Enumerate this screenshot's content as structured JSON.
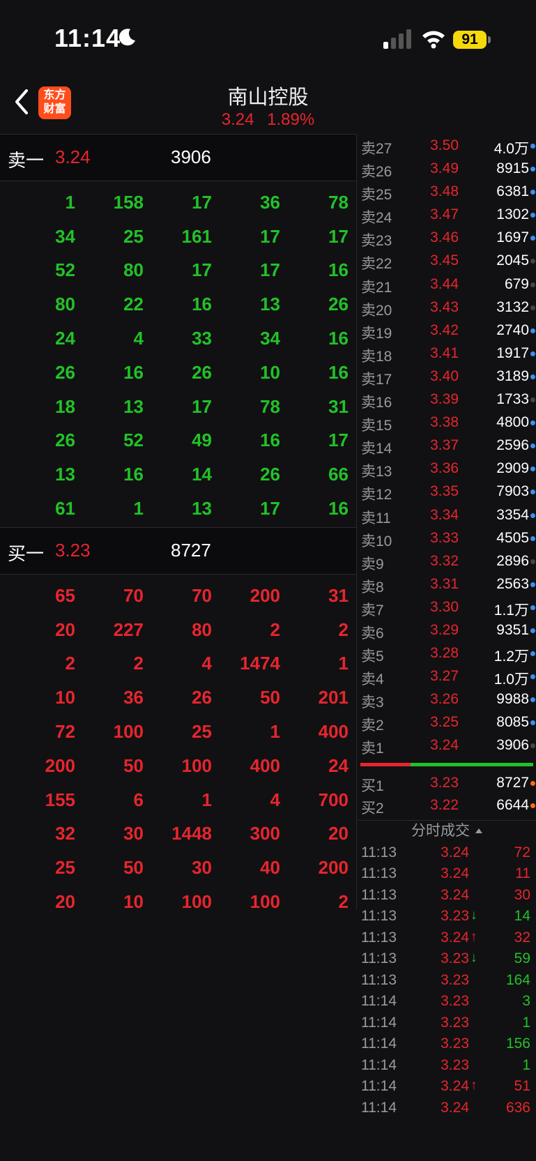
{
  "status": {
    "time": "11:14",
    "battery": "91"
  },
  "header": {
    "logo_line1": "东方",
    "logo_line2": "财富",
    "stock_name": "南山控股",
    "price": "3.24",
    "change_pct": "1.89%"
  },
  "colors": {
    "red": "#e8252d",
    "green": "#22c227",
    "blue_dot": "#3e8ef0",
    "gray_dot": "#444448",
    "orange_dot": "#ff6a1a"
  },
  "sell_block": {
    "label": "卖一",
    "price": "3.24",
    "volume": "3906",
    "rows": [
      [
        "1",
        "158",
        "17",
        "36",
        "78"
      ],
      [
        "34",
        "25",
        "161",
        "17",
        "17"
      ],
      [
        "52",
        "80",
        "17",
        "17",
        "16"
      ],
      [
        "80",
        "22",
        "16",
        "13",
        "26"
      ],
      [
        "24",
        "4",
        "33",
        "34",
        "16"
      ],
      [
        "26",
        "16",
        "26",
        "10",
        "16"
      ],
      [
        "18",
        "13",
        "17",
        "78",
        "31"
      ],
      [
        "26",
        "52",
        "49",
        "16",
        "17"
      ],
      [
        "13",
        "16",
        "14",
        "26",
        "66"
      ],
      [
        "61",
        "1",
        "13",
        "17",
        "16"
      ]
    ]
  },
  "buy_block": {
    "label": "买一",
    "price": "3.23",
    "volume": "8727",
    "rows": [
      [
        "65",
        "70",
        "70",
        "200",
        "31"
      ],
      [
        "20",
        "227",
        "80",
        "2",
        "2"
      ],
      [
        "2",
        "2",
        "4",
        "1474",
        "1"
      ],
      [
        "10",
        "36",
        "26",
        "50",
        "201"
      ],
      [
        "72",
        "100",
        "25",
        "1",
        "400"
      ],
      [
        "200",
        "50",
        "100",
        "400",
        "24"
      ],
      [
        "155",
        "6",
        "1",
        "4",
        "700"
      ],
      [
        "32",
        "30",
        "1448",
        "300",
        "20"
      ],
      [
        "25",
        "50",
        "30",
        "40",
        "200"
      ],
      [
        "20",
        "10",
        "100",
        "100",
        "2"
      ]
    ]
  },
  "asks": [
    {
      "label": "卖27",
      "price": "3.50",
      "vol": "4.0万",
      "dot": "blue"
    },
    {
      "label": "卖26",
      "price": "3.49",
      "vol": "8915",
      "dot": "blue"
    },
    {
      "label": "卖25",
      "price": "3.48",
      "vol": "6381",
      "dot": "blue"
    },
    {
      "label": "卖24",
      "price": "3.47",
      "vol": "1302",
      "dot": "blue"
    },
    {
      "label": "卖23",
      "price": "3.46",
      "vol": "1697",
      "dot": "blue"
    },
    {
      "label": "卖22",
      "price": "3.45",
      "vol": "2045",
      "dot": "gray"
    },
    {
      "label": "卖21",
      "price": "3.44",
      "vol": "679",
      "dot": "gray"
    },
    {
      "label": "卖20",
      "price": "3.43",
      "vol": "3132",
      "dot": "gray"
    },
    {
      "label": "卖19",
      "price": "3.42",
      "vol": "2740",
      "dot": "blue"
    },
    {
      "label": "卖18",
      "price": "3.41",
      "vol": "1917",
      "dot": "blue"
    },
    {
      "label": "卖17",
      "price": "3.40",
      "vol": "3189",
      "dot": "blue"
    },
    {
      "label": "卖16",
      "price": "3.39",
      "vol": "1733",
      "dot": "gray"
    },
    {
      "label": "卖15",
      "price": "3.38",
      "vol": "4800",
      "dot": "blue"
    },
    {
      "label": "卖14",
      "price": "3.37",
      "vol": "2596",
      "dot": "blue"
    },
    {
      "label": "卖13",
      "price": "3.36",
      "vol": "2909",
      "dot": "blue"
    },
    {
      "label": "卖12",
      "price": "3.35",
      "vol": "7903",
      "dot": "blue"
    },
    {
      "label": "卖11",
      "price": "3.34",
      "vol": "3354",
      "dot": "blue"
    },
    {
      "label": "卖10",
      "price": "3.33",
      "vol": "4505",
      "dot": "blue"
    },
    {
      "label": "卖9",
      "price": "3.32",
      "vol": "2896",
      "dot": "gray"
    },
    {
      "label": "卖8",
      "price": "3.31",
      "vol": "2563",
      "dot": "blue"
    },
    {
      "label": "卖7",
      "price": "3.30",
      "vol": "1.1万",
      "dot": "blue"
    },
    {
      "label": "卖6",
      "price": "3.29",
      "vol": "9351",
      "dot": "blue"
    },
    {
      "label": "卖5",
      "price": "3.28",
      "vol": "1.2万",
      "dot": "blue"
    },
    {
      "label": "卖4",
      "price": "3.27",
      "vol": "1.0万",
      "dot": "blue"
    },
    {
      "label": "卖3",
      "price": "3.26",
      "vol": "9988",
      "dot": "blue"
    },
    {
      "label": "卖2",
      "price": "3.25",
      "vol": "8085",
      "dot": "blue"
    },
    {
      "label": "卖1",
      "price": "3.24",
      "vol": "3906",
      "dot": "gray"
    }
  ],
  "bids": [
    {
      "label": "买1",
      "price": "3.23",
      "vol": "8727",
      "dot": "orange"
    },
    {
      "label": "买2",
      "price": "3.22",
      "vol": "6644",
      "dot": "orange"
    }
  ],
  "trades_title": "分时成交",
  "trades": [
    {
      "time": "11:13",
      "price": "3.24",
      "arrow": "",
      "vol": "72",
      "side": "red"
    },
    {
      "time": "11:13",
      "price": "3.24",
      "arrow": "",
      "vol": "11",
      "side": "red"
    },
    {
      "time": "11:13",
      "price": "3.24",
      "arrow": "",
      "vol": "30",
      "side": "red"
    },
    {
      "time": "11:13",
      "price": "3.23",
      "arrow": "↓",
      "vol": "14",
      "side": "green"
    },
    {
      "time": "11:13",
      "price": "3.24",
      "arrow": "↑",
      "vol": "32",
      "side": "red"
    },
    {
      "time": "11:13",
      "price": "3.23",
      "arrow": "↓",
      "vol": "59",
      "side": "green"
    },
    {
      "time": "11:13",
      "price": "3.23",
      "arrow": "",
      "vol": "164",
      "side": "green"
    },
    {
      "time": "11:14",
      "price": "3.23",
      "arrow": "",
      "vol": "3",
      "side": "green"
    },
    {
      "time": "11:14",
      "price": "3.23",
      "arrow": "",
      "vol": "1",
      "side": "green"
    },
    {
      "time": "11:14",
      "price": "3.23",
      "arrow": "",
      "vol": "156",
      "side": "green"
    },
    {
      "time": "11:14",
      "price": "3.23",
      "arrow": "",
      "vol": "1",
      "side": "green"
    },
    {
      "time": "11:14",
      "price": "3.24",
      "arrow": "↑",
      "vol": "51",
      "side": "red"
    },
    {
      "time": "11:14",
      "price": "3.24",
      "arrow": "",
      "vol": "636",
      "side": "red"
    }
  ]
}
